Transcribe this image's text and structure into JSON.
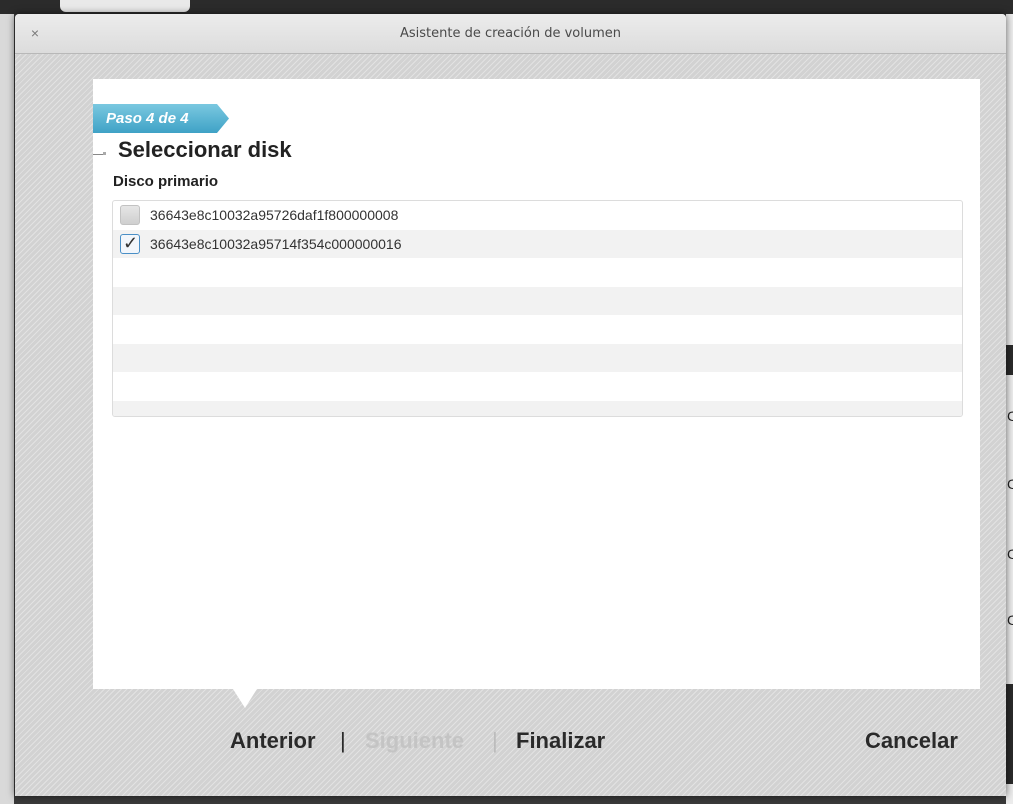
{
  "dialog": {
    "title": "Asistente de creación de volumen",
    "close_icon": "close-icon",
    "close_glyph": "×"
  },
  "wizard": {
    "step_label": "Paso 4 de 4",
    "heading": "Seleccionar disk",
    "section_label": "Disco primario",
    "disks": [
      {
        "id": "36643e8c10032a95726daf1f800000008",
        "checked": false
      },
      {
        "id": "36643e8c10032a95714f354c000000016",
        "checked": true
      }
    ]
  },
  "footer": {
    "prev_label": "Anterior",
    "separator": "|",
    "next_label": "Siguiente",
    "finish_label": "Finalizar",
    "cancel_label": "Cancelar"
  },
  "background": {
    "right_edge_letters": [
      "C",
      "C",
      "C",
      "C"
    ]
  },
  "colors": {
    "step_badge": "#3fa2c6",
    "panel": "#ffffff",
    "checkbox_border_checked": "#4a8fc6"
  }
}
